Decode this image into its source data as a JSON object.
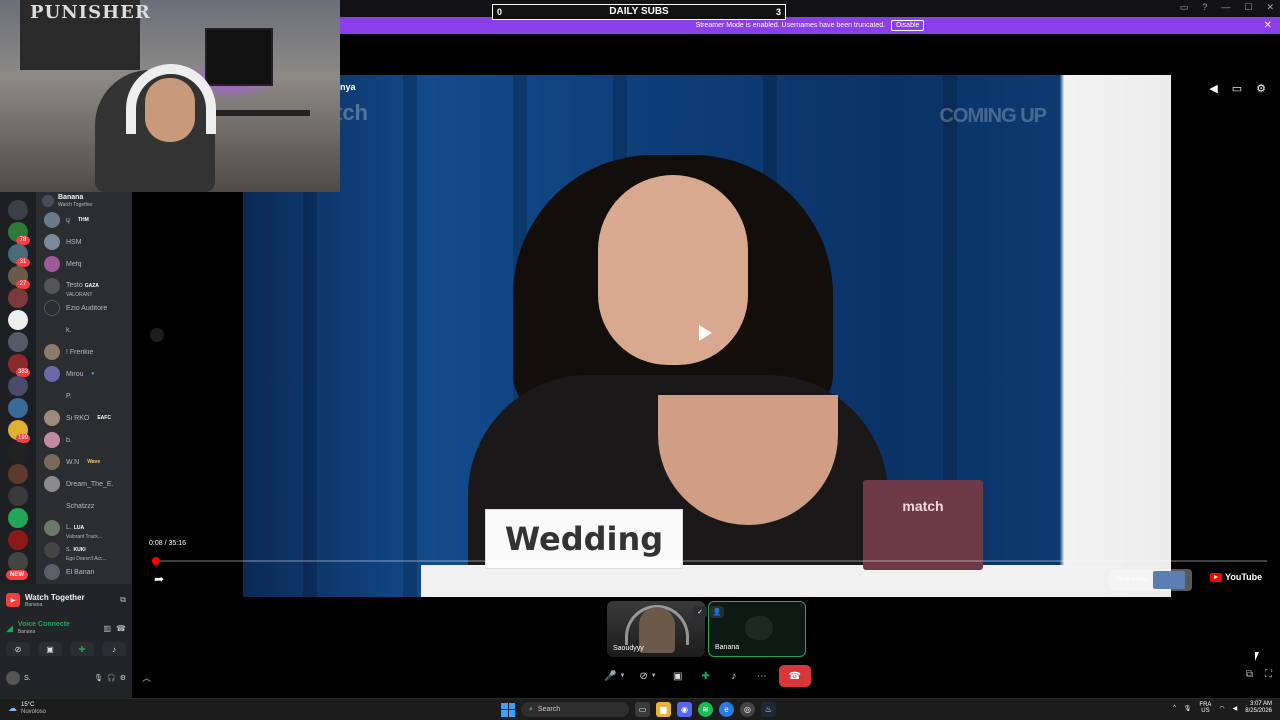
{
  "topbar": {
    "subs_left": "0",
    "subs_title": "DAILY SUBS",
    "subs_right": "3",
    "banner_text": "Streamer Mode is enabled. Usernames have been truncated.",
    "banner_button": "Disable"
  },
  "webcam": {
    "poster_text": "PUNISHER"
  },
  "server_rail": {
    "badges": [
      "78",
      "31",
      "27",
      "383",
      "199"
    ],
    "new_label": "NEW"
  },
  "voice_channel": {
    "name": "Banana",
    "activity": "Watch Together"
  },
  "members": [
    {
      "name": "ų",
      "tag": "THM"
    },
    {
      "name": "HSM",
      "tag": ""
    },
    {
      "name": "Mefq",
      "tag": ""
    },
    {
      "name": "Testo",
      "tag": "GAZA",
      "sub": "VALORANT"
    },
    {
      "name": "Ezio Auditore",
      "tag": ""
    },
    {
      "name": "k.",
      "tag": ""
    },
    {
      "name": "! Frenkie",
      "tag": ""
    },
    {
      "name": "Mirou",
      "tag": ""
    },
    {
      "name": "P.",
      "tag": ""
    },
    {
      "name": "Si RKO",
      "tag": "EAFC"
    },
    {
      "name": "b.",
      "tag": ""
    },
    {
      "name": "W.N",
      "tag": "Wave"
    },
    {
      "name": "Dream_The_E.",
      "tag": ""
    },
    {
      "name": "Schatzzz",
      "tag": ""
    },
    {
      "name": "L.",
      "tag": "LUA",
      "sub": "Valorant Track..."
    },
    {
      "name": "s.",
      "tag": "KUKI",
      "sub": "Ego Doesn't Acc..."
    },
    {
      "name": "El Banan",
      "tag": ""
    }
  ],
  "panel": {
    "watch_title": "Watch Together",
    "watch_sub": "Banana",
    "voice_title": "Voice Connecte",
    "voice_sub": "Banana",
    "user_label": "S."
  },
  "video": {
    "title": "nya",
    "watermark": "tch",
    "coming_up": "COMING UP",
    "card_text": "Wedding",
    "box_text": "match",
    "time": "0:08 / 35:16",
    "progress": 0.0038,
    "more_videos": "More videos",
    "yt_logo": "YouTube"
  },
  "participants": [
    {
      "name": "Saoudyyy"
    },
    {
      "name": "Banana"
    }
  ],
  "taskbar": {
    "temp": "15°C",
    "condition": "Nuvoloso",
    "search": "Search",
    "lang1": "FRA",
    "lang2": "US",
    "time": "3:07 AM",
    "date": "8/25/2026"
  },
  "colors": {
    "banner": "#8b3fe8",
    "accent_green": "#23a55a",
    "danger": "#da373c",
    "progress": "#ff0000"
  }
}
